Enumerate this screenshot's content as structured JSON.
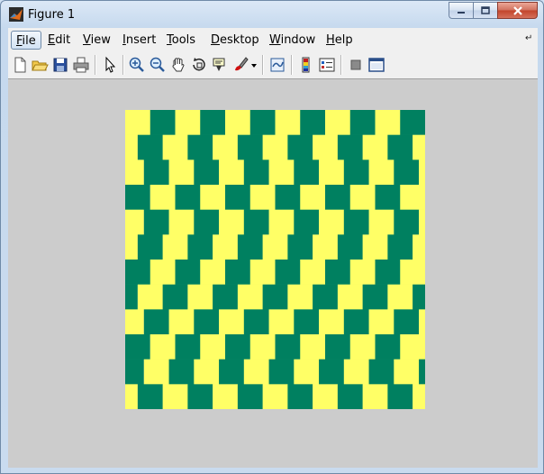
{
  "window": {
    "title": "Figure 1"
  },
  "menu": {
    "items": [
      {
        "name": "file",
        "label": "File"
      },
      {
        "name": "edit",
        "label": "Edit"
      },
      {
        "name": "view",
        "label": "View"
      },
      {
        "name": "insert",
        "label": "Insert"
      },
      {
        "name": "tools",
        "label": "Tools"
      },
      {
        "name": "desktop",
        "label": "Desktop"
      },
      {
        "name": "window",
        "label": "Window"
      },
      {
        "name": "help",
        "label": "Help"
      }
    ]
  },
  "toolbar": {
    "icons": [
      "new-figure-icon",
      "open-file-icon",
      "save-icon",
      "print-icon",
      "edit-plot-arrow-icon",
      "zoom-in-icon",
      "zoom-out-icon",
      "pan-hand-icon",
      "rotate-3d-icon",
      "data-cursor-icon",
      "brush-icon",
      "brush-dropdown-icon",
      "link-plot-icon",
      "insert-colorbar-icon",
      "insert-legend-icon",
      "hide-plot-tools-icon",
      "show-plot-tools-icon"
    ]
  },
  "figure": {
    "rows": 12,
    "cols": 12,
    "colors": {
      "yellow": "#ffff66",
      "green": "#008060",
      "background": "#cccccc"
    },
    "row_offsets": [
      0,
      0.5,
      0.75,
      1.0,
      0.75,
      0.5,
      0,
      0.5,
      0.75,
      1.0,
      0.75,
      0.5
    ],
    "start_color": [
      "yellow",
      "yellow",
      "yellow",
      "green",
      "yellow",
      "yellow",
      "green",
      "green",
      "yellow",
      "green",
      "green",
      "yellow"
    ]
  }
}
